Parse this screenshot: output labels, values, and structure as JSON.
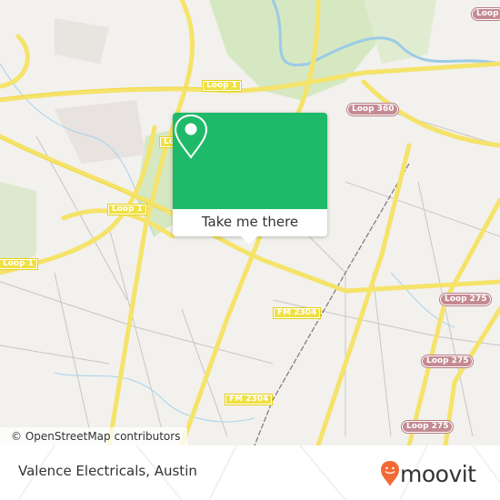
{
  "map": {
    "attribution": "© OpenStreetMap contributors",
    "road_labels": {
      "loop1_a": "Loop 1",
      "loop1_b": "Loop 1",
      "loop1_c": "Loop 1",
      "loop1_d": "Loop 1",
      "loop360": "Loop 360",
      "loop_top_right": "Loop",
      "loop275_a": "Loop 275",
      "loop275_b": "Loop 275",
      "loop275_c": "Loop 275",
      "fm2304_a": "FM 2304",
      "fm2304_b": "FM 2304"
    }
  },
  "popup": {
    "icon": "map-pin-icon",
    "button_label": "Take me there",
    "color": "#1fba69"
  },
  "footer": {
    "title": "Valence Electricals, Austin",
    "brand": "moovit",
    "brand_color": "#f26a36"
  }
}
